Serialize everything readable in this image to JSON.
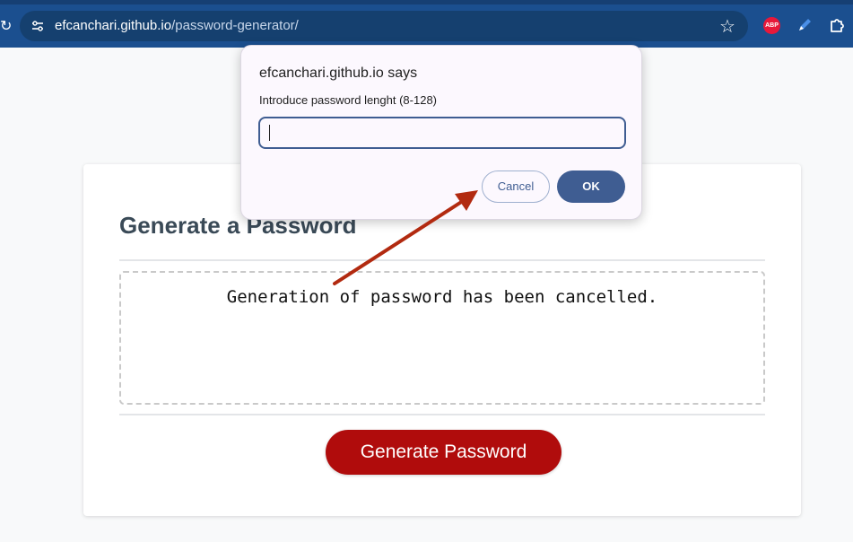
{
  "browser": {
    "url_host": "efcanchari.github.io",
    "url_path": "/password-generator/",
    "icons": [
      "reload-icon",
      "site-info-icon",
      "bookmark-star-icon",
      "adblock-plus-icon",
      "pen-extension-icon",
      "extensions-puzzle-icon"
    ],
    "extension_abp_label": "ABP",
    "colors": {
      "toolbar": "#1b4f8f",
      "omnibox": "#15406f"
    }
  },
  "page": {
    "title": "Generate a Password",
    "password_output": "Generation of password has been cancelled.",
    "generate_label": "Generate Password",
    "colors": {
      "button": "#b00c0c",
      "title": "#3a4a57"
    }
  },
  "dialog": {
    "title": "efcanchari.github.io says",
    "message": "Introduce password lenght (8-128)",
    "input_value": "",
    "cancel_label": "Cancel",
    "ok_label": "OK",
    "colors": {
      "accent": "#3f5d92",
      "background": "#fcf8fe"
    }
  },
  "annotation": {
    "type": "arrow",
    "color": "#b22a10",
    "points_to": "cancel-button"
  }
}
